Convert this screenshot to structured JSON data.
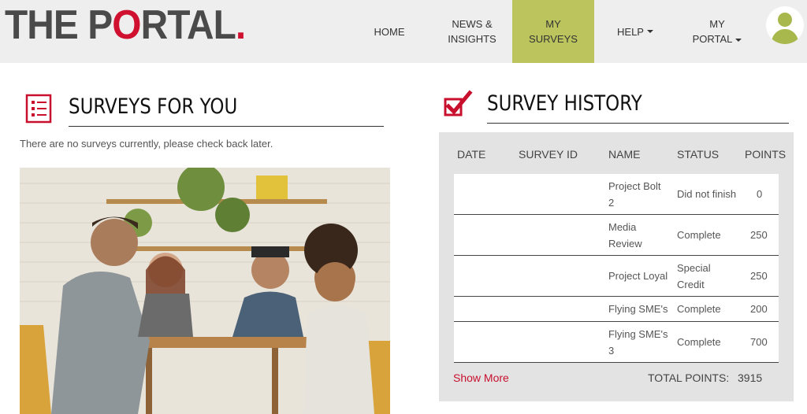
{
  "header": {
    "logo_text_1": "THE P",
    "logo_text_o": "O",
    "logo_text_2": "RTAL",
    "logo_dot": ".",
    "nav": [
      {
        "line1": "HOME",
        "line2": ""
      },
      {
        "line1": "NEWS &",
        "line2": "INSIGHTS"
      },
      {
        "line1": "MY",
        "line2": "SURVEYS"
      },
      {
        "line1": "HELP",
        "line2": ""
      },
      {
        "line1": "MY",
        "line2": "PORTAL"
      }
    ]
  },
  "surveys": {
    "title": "SURVEYS FOR YOU",
    "empty_message": "There are no surveys currently, please check back later."
  },
  "history": {
    "title": "SURVEY HISTORY",
    "columns": [
      "DATE",
      "SURVEY ID",
      "NAME",
      "STATUS",
      "POINTS"
    ],
    "rows": [
      {
        "name_1": "Project Bolt",
        "name_2": "2",
        "status_1": "Did not finish",
        "status_2": "",
        "points": "0"
      },
      {
        "name_1": "Media",
        "name_2": "Review",
        "status_1": "Complete",
        "status_2": "",
        "points": "250"
      },
      {
        "name_1": "Project Loyal",
        "name_2": "",
        "status_1": "Special",
        "status_2": "Credit",
        "points": "250"
      },
      {
        "name_1": "Flying SME's",
        "name_2": "",
        "status_1": "Complete",
        "status_2": "",
        "points": "200"
      },
      {
        "name_1": "Flying SME's",
        "name_2": "3",
        "status_1": "Complete",
        "status_2": "",
        "points": "700"
      }
    ],
    "show_more": "Show More",
    "total_label": "TOTAL POINTS:",
    "total_value": "3915"
  },
  "colors": {
    "accent_red": "#d0102f",
    "nav_active": "#bcc55d",
    "avatar_green": "#a9b84c"
  },
  "icons": {
    "surveys_icon": "list-icon",
    "history_icon": "checkbox-check-icon",
    "avatar_icon": "user-icon"
  }
}
